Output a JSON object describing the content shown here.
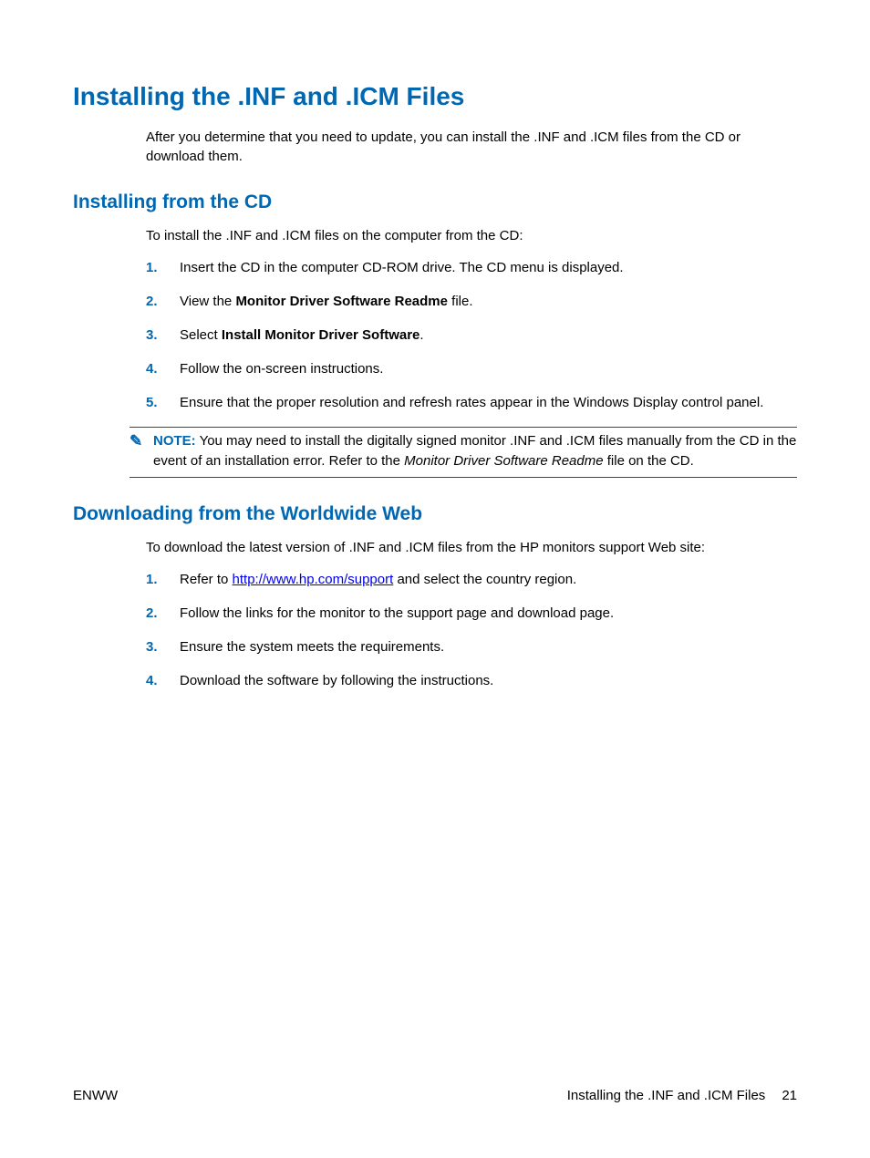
{
  "h1": "Installing the .INF and .ICM Files",
  "intro": "After you determine that you need to update, you can install the .INF and .ICM files from the CD or download them.",
  "section1": {
    "heading": "Installing from the CD",
    "lead": "To install the .INF and .ICM files on the computer from the CD:",
    "steps": {
      "s1": "Insert the CD in the computer CD-ROM drive. The CD menu is displayed.",
      "s2a": "View the ",
      "s2b": "Monitor Driver Software Readme",
      "s2c": " file.",
      "s3a": "Select ",
      "s3b": "Install Monitor Driver Software",
      "s3c": ".",
      "s4": "Follow the on-screen instructions.",
      "s5": "Ensure that the proper resolution and refresh rates appear in the Windows Display control panel."
    },
    "note": {
      "label": "NOTE:",
      "t1": "You may need to install the digitally signed monitor .INF and .ICM files manually from the CD in the event of an installation error. Refer to the ",
      "italic": "Monitor Driver Software Readme",
      "t2": " file on the CD."
    }
  },
  "section2": {
    "heading": "Downloading from the Worldwide Web",
    "lead": "To download the latest version of .INF and .ICM files from the HP monitors support Web site:",
    "steps": {
      "s1a": "Refer to ",
      "s1link": "http://www.hp.com/support",
      "s1b": " and select the country region.",
      "s2": "Follow the links for the monitor to the support page and download page.",
      "s3": "Ensure the system meets the requirements.",
      "s4": "Download the software by following the instructions."
    }
  },
  "footer": {
    "left": "ENWW",
    "rightTitle": "Installing the .INF and .ICM Files",
    "pageNum": "21"
  }
}
